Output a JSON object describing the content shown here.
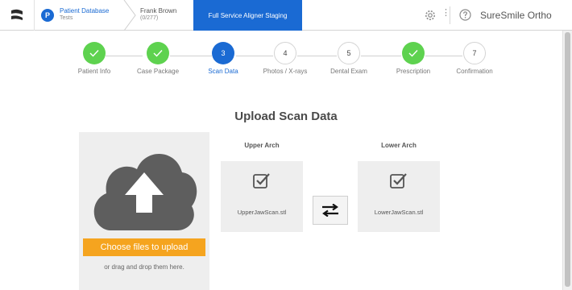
{
  "header": {
    "breadcrumb": [
      {
        "title": "Patient Database",
        "subtitle": "Tests",
        "badge": "P"
      },
      {
        "title": "Frank Brown",
        "subtitle": "(0/277)"
      }
    ],
    "active_tab": "Full Service Aligner Staging",
    "more_symbol": "⋮",
    "brand": "SureSmile Ortho",
    "icons": {
      "logo": "suresmile-logo-icon",
      "gear": "gear-icon",
      "help": "help-icon"
    }
  },
  "stepper": {
    "steps": [
      {
        "label": "Patient Info",
        "state": "done",
        "number": ""
      },
      {
        "label": "Case Package",
        "state": "done",
        "number": ""
      },
      {
        "label": "Scan Data",
        "state": "current",
        "number": "3"
      },
      {
        "label": "Photos / X-rays",
        "state": "todo",
        "number": "4"
      },
      {
        "label": "Dental Exam",
        "state": "todo",
        "number": "5"
      },
      {
        "label": "Prescription",
        "state": "done",
        "number": ""
      },
      {
        "label": "Confirmation",
        "state": "todo",
        "number": "7"
      }
    ]
  },
  "main": {
    "title": "Upload Scan Data",
    "upload": {
      "button_label": "Choose files to upload",
      "hint": "or drag and drop them here."
    },
    "upper_arch": {
      "label": "Upper Arch",
      "file": "UpperJawScan.stl"
    },
    "lower_arch": {
      "label": "Lower Arch",
      "file": "LowerJawScan.stl"
    }
  },
  "colors": {
    "primary": "#1a6ad3",
    "done": "#5ed24f",
    "upload_button": "#f5a41f",
    "panel": "#eeeeee"
  }
}
